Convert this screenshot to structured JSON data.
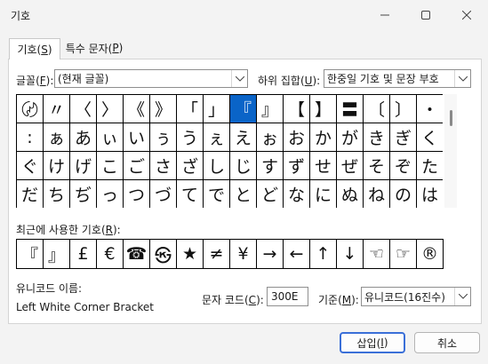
{
  "window": {
    "title": "기호"
  },
  "tabs": [
    {
      "label": "기호(",
      "key": "S",
      "suffix": ")"
    },
    {
      "label": "특수 문자(",
      "key": "P",
      "suffix": ")"
    }
  ],
  "font": {
    "label": "글꼴(",
    "key": "F",
    "suffix": "):",
    "value": "(현재 글꼴)"
  },
  "subset": {
    "label": "하위 집합(",
    "key": "U",
    "suffix": "):",
    "value": "한중일 기호 및 문장 부호"
  },
  "grid": {
    "rows": [
      [
        "〄",
        "〃",
        "〈",
        "〉",
        "《",
        "》",
        "「",
        "」",
        "『",
        "』",
        "【",
        "】",
        "〓",
        "〔",
        "〕",
        "・"
      ],
      [
        ":",
        "ぁ",
        "あ",
        "ぃ",
        "い",
        "ぅ",
        "う",
        "ぇ",
        "え",
        "ぉ",
        "お",
        "か",
        "が",
        "き",
        "ぎ",
        "く"
      ],
      [
        "ぐ",
        "け",
        "げ",
        "こ",
        "ご",
        "さ",
        "ざ",
        "し",
        "じ",
        "す",
        "ず",
        "せ",
        "ぜ",
        "そ",
        "ぞ",
        "た"
      ],
      [
        "だ",
        "ち",
        "ぢ",
        "っ",
        "つ",
        "づ",
        "て",
        "で",
        "と",
        "ど",
        "な",
        "に",
        "ぬ",
        "ね",
        "の",
        "は"
      ]
    ],
    "selected": {
      "row": 0,
      "col": 8
    }
  },
  "recent": {
    "label": "최근에 사용한 기호(",
    "key": "R",
    "suffix": "):",
    "symbols": [
      "『",
      "』",
      "£",
      "€",
      "☎",
      "㉿",
      "★",
      "≠",
      "¥",
      "→",
      "←",
      "↑",
      "↓",
      "☜",
      "☞",
      "®"
    ]
  },
  "unicode_name": {
    "label": "유니코드 이름:",
    "value": "Left White Corner Bracket"
  },
  "char_code": {
    "label": "문자 코드(",
    "key": "C",
    "suffix": "):",
    "value": "300E"
  },
  "from": {
    "label": "기준(",
    "key": "M",
    "suffix": "):",
    "value": "유니코드(16진수)"
  },
  "buttons": {
    "insert": {
      "label": "삽입(",
      "key": "I",
      "suffix": ")"
    },
    "cancel": {
      "label": "취소"
    }
  }
}
